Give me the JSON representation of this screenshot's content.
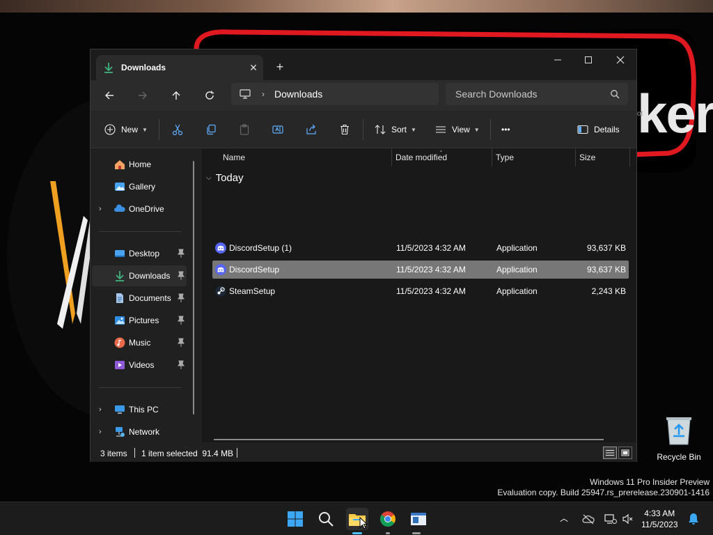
{
  "desktop": {
    "wallpaper_text": "ker",
    "wallpaper_small_text": "ot",
    "recycle_bin_label": "Recycle Bin",
    "watermark_line1": "Windows 11 Pro Insider Preview",
    "watermark_line2": "Evaluation copy. Build 25947.rs_prerelease.230901-1416"
  },
  "window": {
    "tab_title": "Downloads",
    "tab_close": "✕",
    "new_tab": "+",
    "minimize": "─",
    "maximize": "☐",
    "close": "✕",
    "address": {
      "chevron": "›",
      "current": "Downloads"
    },
    "search_placeholder": "Search Downloads"
  },
  "toolbar": {
    "new_label": "New",
    "sort_label": "Sort",
    "view_label": "View",
    "more_label": "•••",
    "details_label": "Details"
  },
  "navigation": {
    "expander": "›",
    "items": [
      {
        "label": "Home",
        "icon": "home-icon"
      },
      {
        "label": "Gallery",
        "icon": "gallery-icon"
      },
      {
        "label": "OneDrive",
        "icon": "onedrive-icon"
      },
      {
        "label": "Desktop",
        "icon": "desktop-icon"
      },
      {
        "label": "Downloads",
        "icon": "download-icon"
      },
      {
        "label": "Documents",
        "icon": "documents-icon"
      },
      {
        "label": "Pictures",
        "icon": "pictures-icon"
      },
      {
        "label": "Music",
        "icon": "music-icon"
      },
      {
        "label": "Videos",
        "icon": "videos-icon"
      },
      {
        "label": "This PC",
        "icon": "computer-icon"
      },
      {
        "label": "Network",
        "icon": "network-icon"
      }
    ]
  },
  "columns": {
    "name": "Name",
    "date": "Date modified",
    "type": "Type",
    "size": "Size"
  },
  "group": {
    "chevron": "⌵",
    "label": "Today"
  },
  "files": [
    {
      "name": "DiscordSetup (1)",
      "date": "11/5/2023 4:32 AM",
      "type": "Application",
      "size": "93,637 KB",
      "icon": "discord-icon"
    },
    {
      "name": "DiscordSetup",
      "date": "11/5/2023 4:32 AM",
      "type": "Application",
      "size": "93,637 KB",
      "icon": "discord-icon"
    },
    {
      "name": "SteamSetup",
      "date": "11/5/2023 4:32 AM",
      "type": "Application",
      "size": "2,243 KB",
      "icon": "steam-icon"
    }
  ],
  "status": {
    "items_count": "3 items",
    "selection": "1 item selected  91.4 MB"
  },
  "taskbar": {
    "tray_chevron": "︿",
    "time": "4:33 AM",
    "date": "11/5/2023"
  },
  "colors": {
    "accent": "#4cc2ff",
    "selected_row": "#777777",
    "discord": "#5865f2",
    "download_green": "#3fb27f"
  }
}
